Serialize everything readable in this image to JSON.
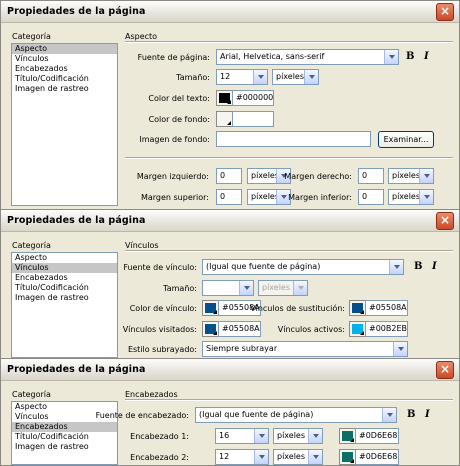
{
  "window_title": "Propiedades de la página",
  "close_glyph": "×",
  "category_label": "Categoría",
  "categories": [
    "Aspecto",
    "Vínculos",
    "Encabezados",
    "Título/Codificación",
    "Imagen de rastreo"
  ],
  "bold_glyph": "B",
  "italic_glyph": "I",
  "units": "píxeles",
  "aspecto": {
    "heading": "Aspecto",
    "page_font_label": "Fuente de página:",
    "page_font_value": "Arial, Helvetica, sans-serif",
    "size_label": "Tamaño:",
    "size_value": "12",
    "text_color_label": "Color del texto:",
    "text_color_value": "#000000",
    "bg_color_label": "Color de fondo:",
    "bg_color_value": "",
    "bg_image_label": "Imagen de fondo:",
    "bg_image_value": "",
    "browse_label": "Examinar...",
    "margin_left_label": "Margen izquierdo:",
    "margin_left_value": "0",
    "margin_right_label": "Margen derecho:",
    "margin_right_value": "0",
    "margin_top_label": "Margen superior:",
    "margin_top_value": "0",
    "margin_bottom_label": "Margen inferior:",
    "margin_bottom_value": "0"
  },
  "vinculos": {
    "heading": "Vínculos",
    "link_font_label": "Fuente de vínculo:",
    "link_font_value": "(Igual que fuente de página)",
    "size_label": "Tamaño:",
    "size_value": "",
    "link_color_label": "Color de vínculo:",
    "link_color_value": "#05508A",
    "rollover_label": "Vínculos de sustitución:",
    "rollover_value": "#05508A",
    "visited_label": "Vínculos visitados:",
    "visited_value": "#05508A",
    "active_label": "Vínculos activos:",
    "active_value": "#00B2EB",
    "underline_label": "Estilo subrayado:",
    "underline_value": "Siempre subrayar"
  },
  "encabezados": {
    "heading": "Encabezados",
    "heading_font_label": "Fuente de encabezado:",
    "heading_font_value": "(Igual que fuente de página)",
    "h1_label": "Encabezado 1:",
    "h1_size": "16",
    "h1_color": "#0D6E68",
    "h2_label": "Encabezado 2:",
    "h2_size": "12",
    "h2_color": "#0D6E68"
  }
}
